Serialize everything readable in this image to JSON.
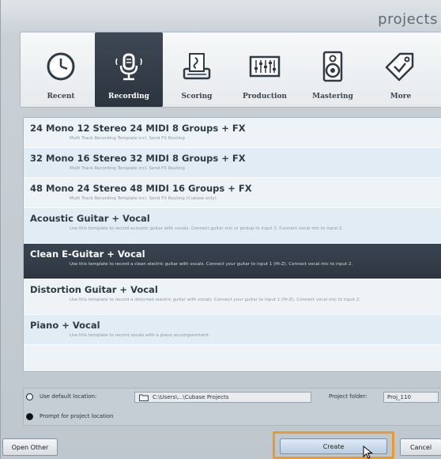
{
  "window": {
    "title": "projects"
  },
  "categories": [
    {
      "label": "Recent",
      "icon": "clock-icon",
      "selected": false
    },
    {
      "label": "Recording",
      "icon": "microphone-icon",
      "selected": true
    },
    {
      "label": "Scoring",
      "icon": "score-icon",
      "selected": false
    },
    {
      "label": "Production",
      "icon": "mixer-icon",
      "selected": false
    },
    {
      "label": "Mastering",
      "icon": "speaker-icon",
      "selected": false
    },
    {
      "label": "More",
      "icon": "tag-icon",
      "selected": false
    }
  ],
  "templates": [
    {
      "title": "24 Mono 12 Stereo 24 MIDI 8 Groups + FX",
      "desc": "Multi Track Recording Template incl. Send FX Routing"
    },
    {
      "title": "32 Mono 16 Stereo 32 MIDI 8 Groups + FX",
      "desc": "Multi Track Recording Template incl. Send FX Routing"
    },
    {
      "title": "48 Mono 24 Stereo 48 MIDI 16 Groups + FX",
      "desc": "Multi Track Recording Template incl. Send FX Routing (Cubase only)"
    },
    {
      "title": "Acoustic Guitar + Vocal",
      "desc": "Use this template to record acoustic guitar with vocals. Connect guitar mic or pickup to input 1. Connect vocal mic to input 2."
    },
    {
      "title": "Clean E-Guitar + Vocal",
      "desc": "Use this template to record a clean electric guitar with vocals. Connect your guitar to input 1 (Hi-Z). Connect vocal mic to input 2."
    },
    {
      "title": "Distortion Guitar + Vocal",
      "desc": "Use this template to record a distorted electric guitar with vocals. Connect your guitar to input 1 (Hi-Z). Connect vocal mic to input 2."
    },
    {
      "title": "Piano + Vocal",
      "desc": "Use this template to record vocals with a piano accompaniment."
    }
  ],
  "location": {
    "default_label": "Use default location:",
    "path": "C:\\Users\\...\\Cubase Projects",
    "project_folder_label": "Project folder:",
    "project_folder_value": "Proj_110",
    "prompt_label": "Prompt for project location"
  },
  "buttons": {
    "open_other": "Open Other",
    "create": "Create",
    "cancel": "Cancel"
  },
  "colors": {
    "selected_bg": "#2d3540",
    "highlight_border": "#e89a2e"
  }
}
